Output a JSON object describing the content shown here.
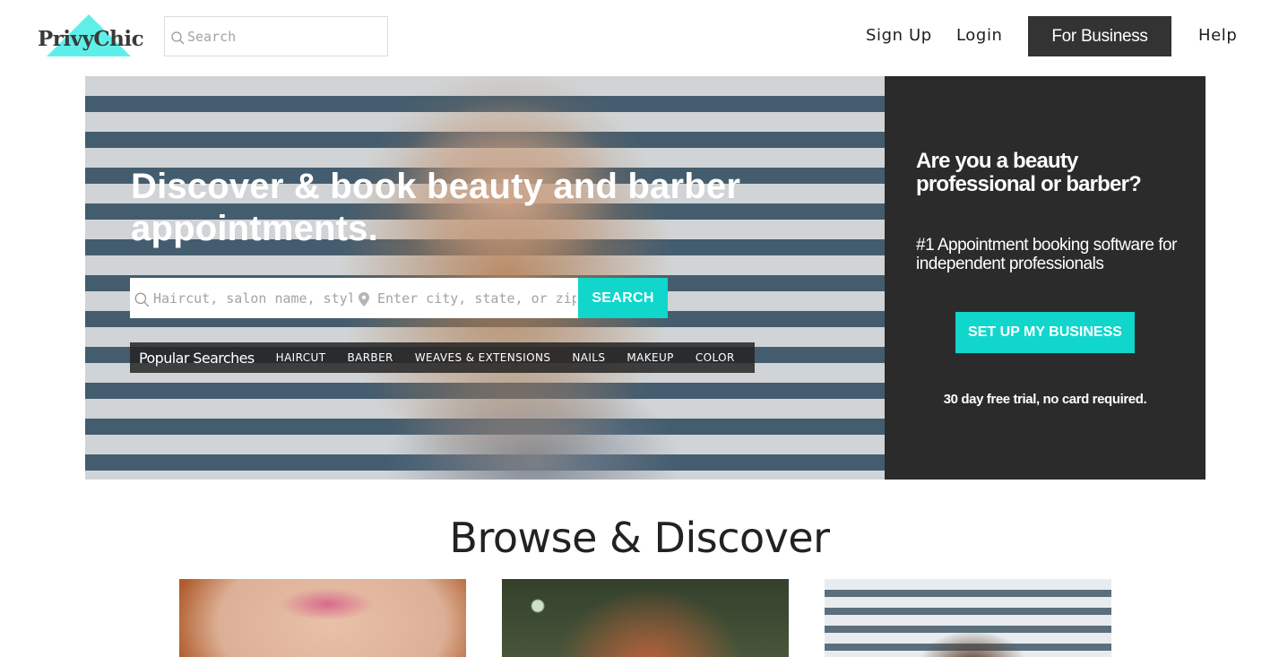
{
  "header": {
    "logo_text": "PrivyChic",
    "search_placeholder": "Search",
    "nav": {
      "signup": "Sign Up",
      "login": "Login",
      "business": "For Business",
      "help": "Help"
    }
  },
  "hero": {
    "title": "Discover & book beauty and barber appointments.",
    "search": {
      "what_placeholder": "Haircut, salon name, stylist name",
      "where_placeholder": "Enter city, state, or zipcode",
      "button": "SEARCH"
    },
    "popular": {
      "label": "Popular Searches",
      "tags": [
        "HAIRCUT",
        "BARBER",
        "WEAVES & EXTENSIONS",
        "NAILS",
        "MAKEUP",
        "COLOR"
      ]
    }
  },
  "business_panel": {
    "question": "Are you a beauty professional or barber?",
    "subtitle": "#1 Appointment booking software for independent professionals",
    "button": "SET UP MY BUSINESS",
    "note": "30 day free trial, no card required."
  },
  "browse": {
    "title": "Browse & Discover"
  },
  "colors": {
    "accent": "#10d6cc",
    "logo_triangle": "#5ef0e8",
    "dark_panel": "#2b2b2b",
    "business_button": "#333333"
  }
}
